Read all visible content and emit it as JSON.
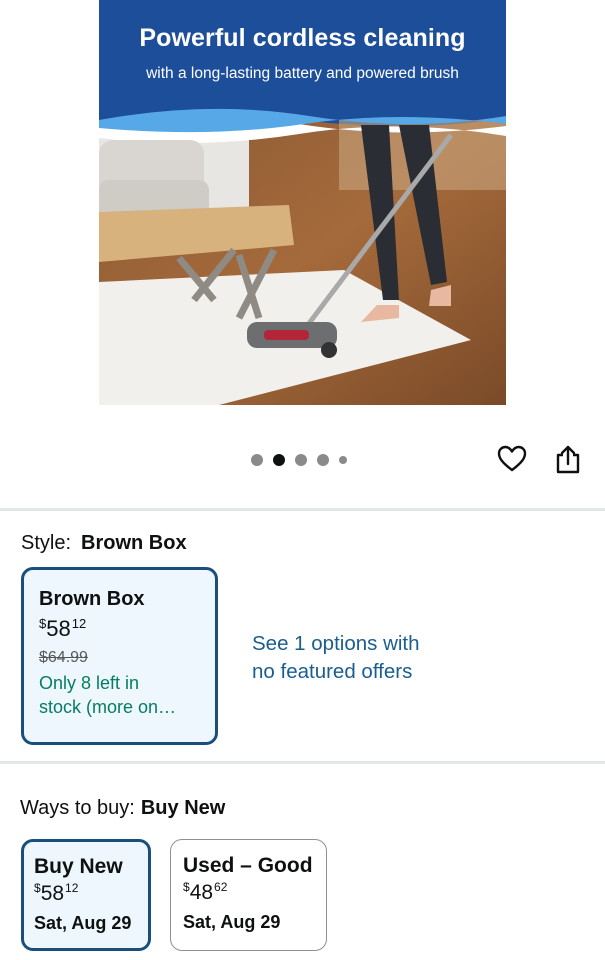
{
  "product_image": {
    "headline": "Powerful cordless cleaning",
    "subline": "with a long-lasting battery and powered brush"
  },
  "carousel": {
    "dot_count": 5,
    "active_index": 1
  },
  "actions": {
    "favorite_icon": "heart-icon",
    "share_icon": "share-icon"
  },
  "style": {
    "label": "Style:",
    "selected": "Brown Box",
    "card": {
      "title": "Brown Box",
      "currency": "$",
      "price_whole": "58",
      "price_fraction": "12",
      "list_price": "$64.99",
      "stock_line1": "Only 8 left in",
      "stock_line2": "stock (more on…"
    },
    "options_link_line1": "See 1 options with",
    "options_link_line2": "no featured offers"
  },
  "ways_to_buy": {
    "label": "Ways to buy:",
    "selected": "Buy New",
    "options": [
      {
        "title": "Buy New",
        "currency": "$",
        "price_whole": "58",
        "price_fraction": "12",
        "delivery": "Sat, Aug 29"
      },
      {
        "title": "Used – Good",
        "currency": "$",
        "price_whole": "48",
        "price_fraction": "62",
        "delivery": "Sat, Aug 29"
      }
    ]
  },
  "colors": {
    "selected_border": "#1a4f7b",
    "selected_bg": "#edf7fd",
    "link": "#1a5e8f",
    "stock_green": "#067d62",
    "image_blue": "#1d4e9a"
  }
}
